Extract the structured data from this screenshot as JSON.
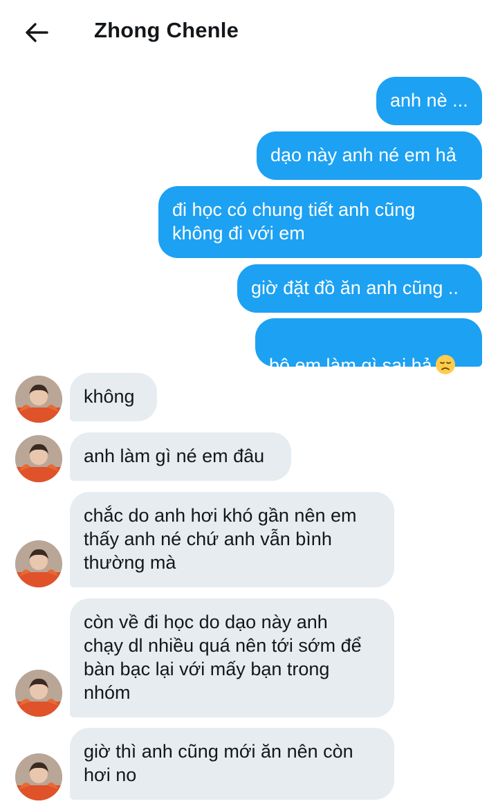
{
  "header": {
    "title": "Zhong Chenle",
    "back_icon": "arrow-left-icon"
  },
  "colors": {
    "outgoing_bubble": "#1da1f2",
    "incoming_bubble": "#e6ecf0",
    "text_dark": "#14171a"
  },
  "messages": {
    "sent": [
      {
        "text": "anh nè ..."
      },
      {
        "text": "dạo này anh né em hả"
      },
      {
        "text": "đi học có chung tiết anh cũng\nkhông đi với em"
      },
      {
        "text": "giờ đặt đồ ăn anh cũng .."
      },
      {
        "text": "bộ em làm gì sai hả",
        "emoji": "disappointed-face-icon"
      }
    ],
    "received": [
      {
        "text": "không"
      },
      {
        "text": "anh làm gì né em đâu"
      },
      {
        "text": "chắc do anh hơi khó gần nên em\nthấy anh né chứ anh vẫn bình\nthường mà"
      },
      {
        "text": "còn về đi học do dạo này anh\nchạy dl nhiều quá nên tới sớm để\nbàn bạc lại với mấy bạn trong\nnhóm"
      },
      {
        "text": "giờ thì anh cũng mới ăn nên còn\nhơi no"
      }
    ]
  }
}
